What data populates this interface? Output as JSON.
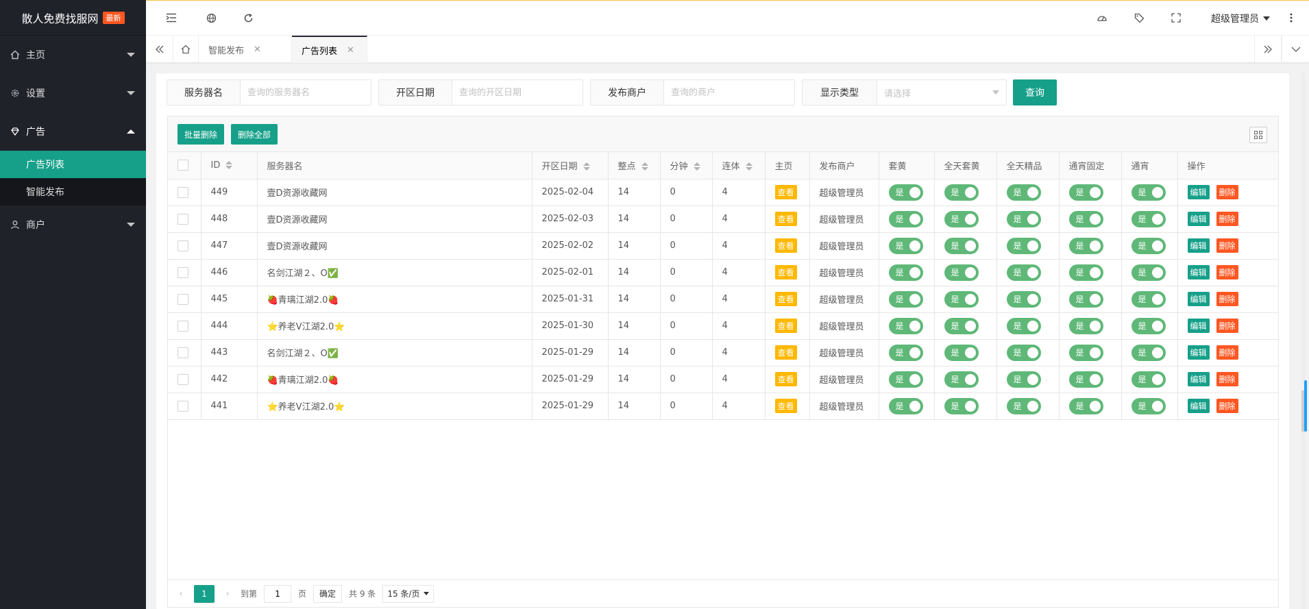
{
  "brand": {
    "name": "散人免费找服网",
    "badge": "最新"
  },
  "sidebar": {
    "items": [
      {
        "label": "主页",
        "icon": "home-icon",
        "open": false
      },
      {
        "label": "设置",
        "icon": "gear-icon",
        "open": false
      },
      {
        "label": "广告",
        "icon": "diamond-icon",
        "open": true,
        "children": [
          {
            "label": "广告列表",
            "active": true
          },
          {
            "label": "智能发布",
            "active": false
          }
        ]
      },
      {
        "label": "商户",
        "icon": "user-icon",
        "open": false
      }
    ]
  },
  "header": {
    "user": "超级管理员"
  },
  "tabs": [
    {
      "label": "智能发布",
      "active": false
    },
    {
      "label": "广告列表",
      "active": true
    }
  ],
  "search": {
    "server_label": "服务器名",
    "server_placeholder": "查询的服务器名",
    "date_label": "开区日期",
    "date_placeholder": "查询的开区日期",
    "merchant_label": "发布商户",
    "merchant_placeholder": "查询的商户",
    "type_label": "显示类型",
    "type_placeholder": "请选择",
    "query_label": "查询"
  },
  "toolbar": {
    "batch_delete": "批量删除",
    "delete_all": "删除全部"
  },
  "table": {
    "headers": [
      "ID",
      "服务器名",
      "开区日期",
      "整点",
      "分钟",
      "连体",
      "主页",
      "发布商户",
      "套黄",
      "全天套黄",
      "全天精品",
      "通宵固定",
      "通宵",
      "操作"
    ],
    "view_label": "查看",
    "switch_label": "是",
    "edit_label": "编辑",
    "delete_label": "删除",
    "rows": [
      {
        "id": "449",
        "name": "壹D资源收藏网",
        "date": "2025-02-04",
        "hour": "14",
        "minute": "0",
        "linked": "4",
        "merchant": "超级管理员"
      },
      {
        "id": "448",
        "name": "壹D资源收藏网",
        "date": "2025-02-03",
        "hour": "14",
        "minute": "0",
        "linked": "4",
        "merchant": "超级管理员"
      },
      {
        "id": "447",
        "name": "壹D资源收藏网",
        "date": "2025-02-02",
        "hour": "14",
        "minute": "0",
        "linked": "4",
        "merchant": "超级管理员"
      },
      {
        "id": "446",
        "name": "名剑江湖２、O✅",
        "date": "2025-02-01",
        "hour": "14",
        "minute": "0",
        "linked": "4",
        "merchant": "超级管理员"
      },
      {
        "id": "445",
        "name": "🍓青璃江湖2.0🍓",
        "date": "2025-01-31",
        "hour": "14",
        "minute": "0",
        "linked": "4",
        "merchant": "超级管理员"
      },
      {
        "id": "444",
        "name": "⭐养老V江湖2.0⭐",
        "date": "2025-01-30",
        "hour": "14",
        "minute": "0",
        "linked": "4",
        "merchant": "超级管理员"
      },
      {
        "id": "443",
        "name": "名剑江湖２、O✅",
        "date": "2025-01-29",
        "hour": "14",
        "minute": "0",
        "linked": "4",
        "merchant": "超级管理员"
      },
      {
        "id": "442",
        "name": "🍓青璃江湖2.0🍓",
        "date": "2025-01-29",
        "hour": "14",
        "minute": "0",
        "linked": "4",
        "merchant": "超级管理员"
      },
      {
        "id": "441",
        "name": "⭐养老V江湖2.0⭐",
        "date": "2025-01-29",
        "hour": "14",
        "minute": "0",
        "linked": "4",
        "merchant": "超级管理员"
      }
    ]
  },
  "pagination": {
    "current": "1",
    "goto_label": "到第",
    "goto_value": "1",
    "page_label": "页",
    "confirm_label": "确定",
    "total_label": "共 9 条",
    "per_page": "15 条/页"
  },
  "colors": {
    "primary": "#16a089",
    "sidebar": "#20222a",
    "danger": "#ff5722",
    "warn": "#ffb800",
    "switch_on": "#5fb878"
  }
}
